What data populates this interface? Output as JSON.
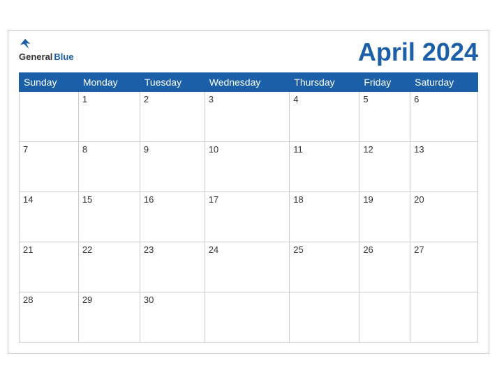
{
  "header": {
    "logo": {
      "general": "General",
      "blue": "Blue"
    },
    "title": "April 2024"
  },
  "days": [
    "Sunday",
    "Monday",
    "Tuesday",
    "Wednesday",
    "Thursday",
    "Friday",
    "Saturday"
  ],
  "weeks": [
    [
      "",
      "1",
      "2",
      "3",
      "4",
      "5",
      "6"
    ],
    [
      "7",
      "8",
      "9",
      "10",
      "11",
      "12",
      "13"
    ],
    [
      "14",
      "15",
      "16",
      "17",
      "18",
      "19",
      "20"
    ],
    [
      "21",
      "22",
      "23",
      "24",
      "25",
      "26",
      "27"
    ],
    [
      "28",
      "29",
      "30",
      "",
      "",
      "",
      ""
    ]
  ]
}
